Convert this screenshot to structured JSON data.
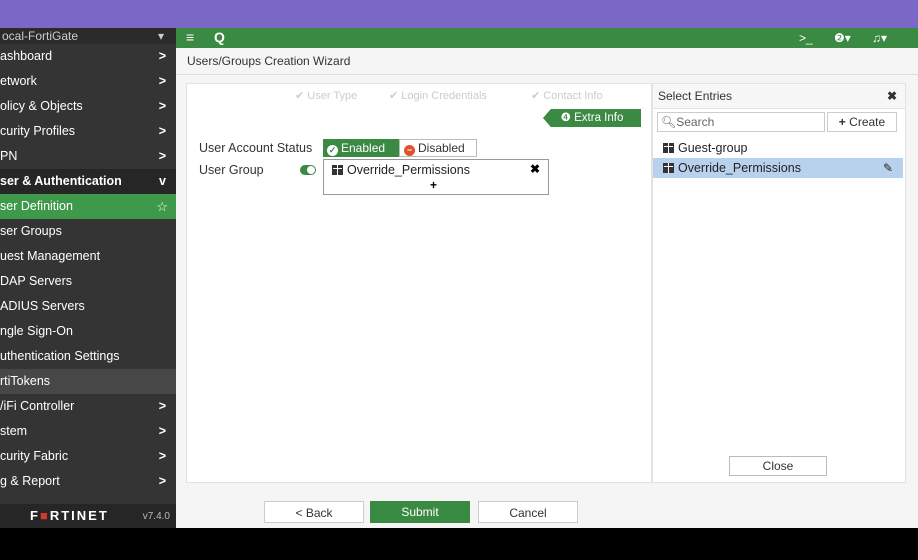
{
  "sidebar": {
    "header": "ocal-FortiGate",
    "items": [
      {
        "label": "ashboard",
        "arrow": ">"
      },
      {
        "label": "etwork",
        "arrow": ">"
      },
      {
        "label": "olicy & Objects",
        "arrow": ">"
      },
      {
        "label": "curity Profiles",
        "arrow": ">"
      },
      {
        "label": "PN",
        "arrow": ">"
      },
      {
        "label": "ser & Authentication",
        "arrow": "v"
      },
      {
        "label": "ser Definition",
        "star": "☆"
      },
      {
        "label": "ser Groups"
      },
      {
        "label": "uest Management"
      },
      {
        "label": "DAP Servers"
      },
      {
        "label": "ADIUS Servers"
      },
      {
        "label": "ngle Sign-On"
      },
      {
        "label": "uthentication Settings"
      },
      {
        "label": "rtiTokens"
      },
      {
        "label": "/iFi Controller",
        "arrow": ">"
      },
      {
        "label": "stem",
        "arrow": ">"
      },
      {
        "label": "curity Fabric",
        "arrow": ">"
      },
      {
        "label": "g & Report",
        "arrow": ">"
      }
    ],
    "logo_a": "F",
    "logo_b": "RTINET",
    "version": "v7.4.0"
  },
  "topbar": {
    "menu": "≡",
    "search": "Q",
    "cli": ">_",
    "help": "❷▾",
    "bell": "♫▾"
  },
  "breadcrumb": "Users/Groups Creation Wizard",
  "wizard": {
    "steps": [
      "✔ User Type",
      "✔ Login Credentials",
      "✔ Contact Info"
    ],
    "current_step": "❹ Extra Info",
    "account_status_label": "User Account Status",
    "enabled": "Enabled",
    "disabled": "Disabled",
    "user_group_label": "User Group",
    "selected_group": "Override_Permissions",
    "remove": "✖",
    "add": "+"
  },
  "select_entries": {
    "title": "Select Entries",
    "close_x": "✖",
    "search_placeholder": "Search",
    "create": "Create",
    "entries": [
      "Guest-group",
      "Override_Permissions"
    ],
    "close": "Close"
  },
  "footer": {
    "back": "< Back",
    "submit": "Submit",
    "cancel": "Cancel"
  }
}
